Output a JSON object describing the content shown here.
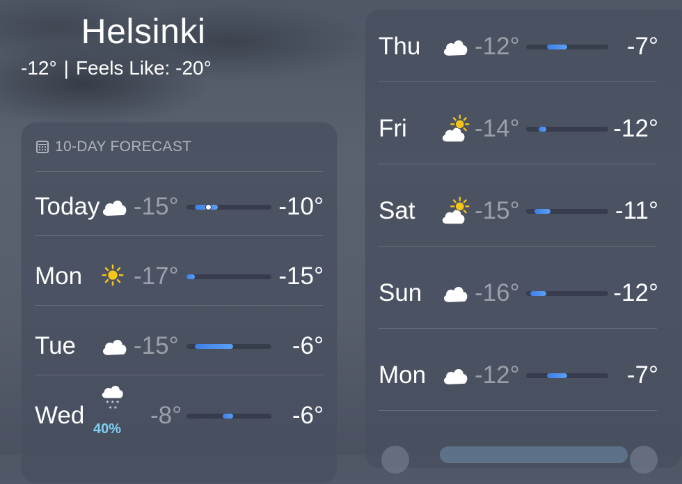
{
  "location": {
    "city": "Helsinki",
    "current_temp": "-12°",
    "separator": "|",
    "feels_like": "Feels Like: -20°"
  },
  "forecast": {
    "title": "10-DAY FORECAST",
    "range_scale_fraction_note_hidden": "",
    "left_rows": [
      {
        "day": "Today",
        "icon": "cloud-icon",
        "low": "-15°",
        "high": "-10°",
        "bar_start": 0.1,
        "bar_end": 0.37,
        "current_marker": 0.25
      },
      {
        "day": "Mon",
        "icon": "sun-icon",
        "low": "-17°",
        "high": "-15°",
        "bar_start": 0.0,
        "bar_end": 0.1
      },
      {
        "day": "Tue",
        "icon": "cloud-icon",
        "low": "-15°",
        "high": "-6°",
        "bar_start": 0.1,
        "bar_end": 0.55
      },
      {
        "day": "Wed",
        "icon": "snow-cloud-icon",
        "low": "-8°",
        "high": "-6°",
        "bar_start": 0.43,
        "bar_end": 0.55,
        "precip": "40%"
      }
    ],
    "right_rows": [
      {
        "day": "Thu",
        "icon": "cloud-icon",
        "low": "-12°",
        "high": "-7°",
        "bar_start": 0.25,
        "bar_end": 0.5
      },
      {
        "day": "Fri",
        "icon": "partly-cloudy-icon",
        "low": "-14°",
        "high": "-12°",
        "bar_start": 0.15,
        "bar_end": 0.25
      },
      {
        "day": "Sat",
        "icon": "partly-cloudy-icon",
        "low": "-15°",
        "high": "-11°",
        "bar_start": 0.1,
        "bar_end": 0.3
      },
      {
        "day": "Sun",
        "icon": "cloud-icon",
        "low": "-16°",
        "high": "-12°",
        "bar_start": 0.05,
        "bar_end": 0.25
      },
      {
        "day": "Mon",
        "icon": "cloud-icon",
        "low": "-12°",
        "high": "-7°",
        "bar_start": 0.25,
        "bar_end": 0.5
      }
    ]
  },
  "colors": {
    "bar_fill": "#4a8ff0",
    "precip": "#7fd0f3",
    "sun": "#f5c518"
  }
}
